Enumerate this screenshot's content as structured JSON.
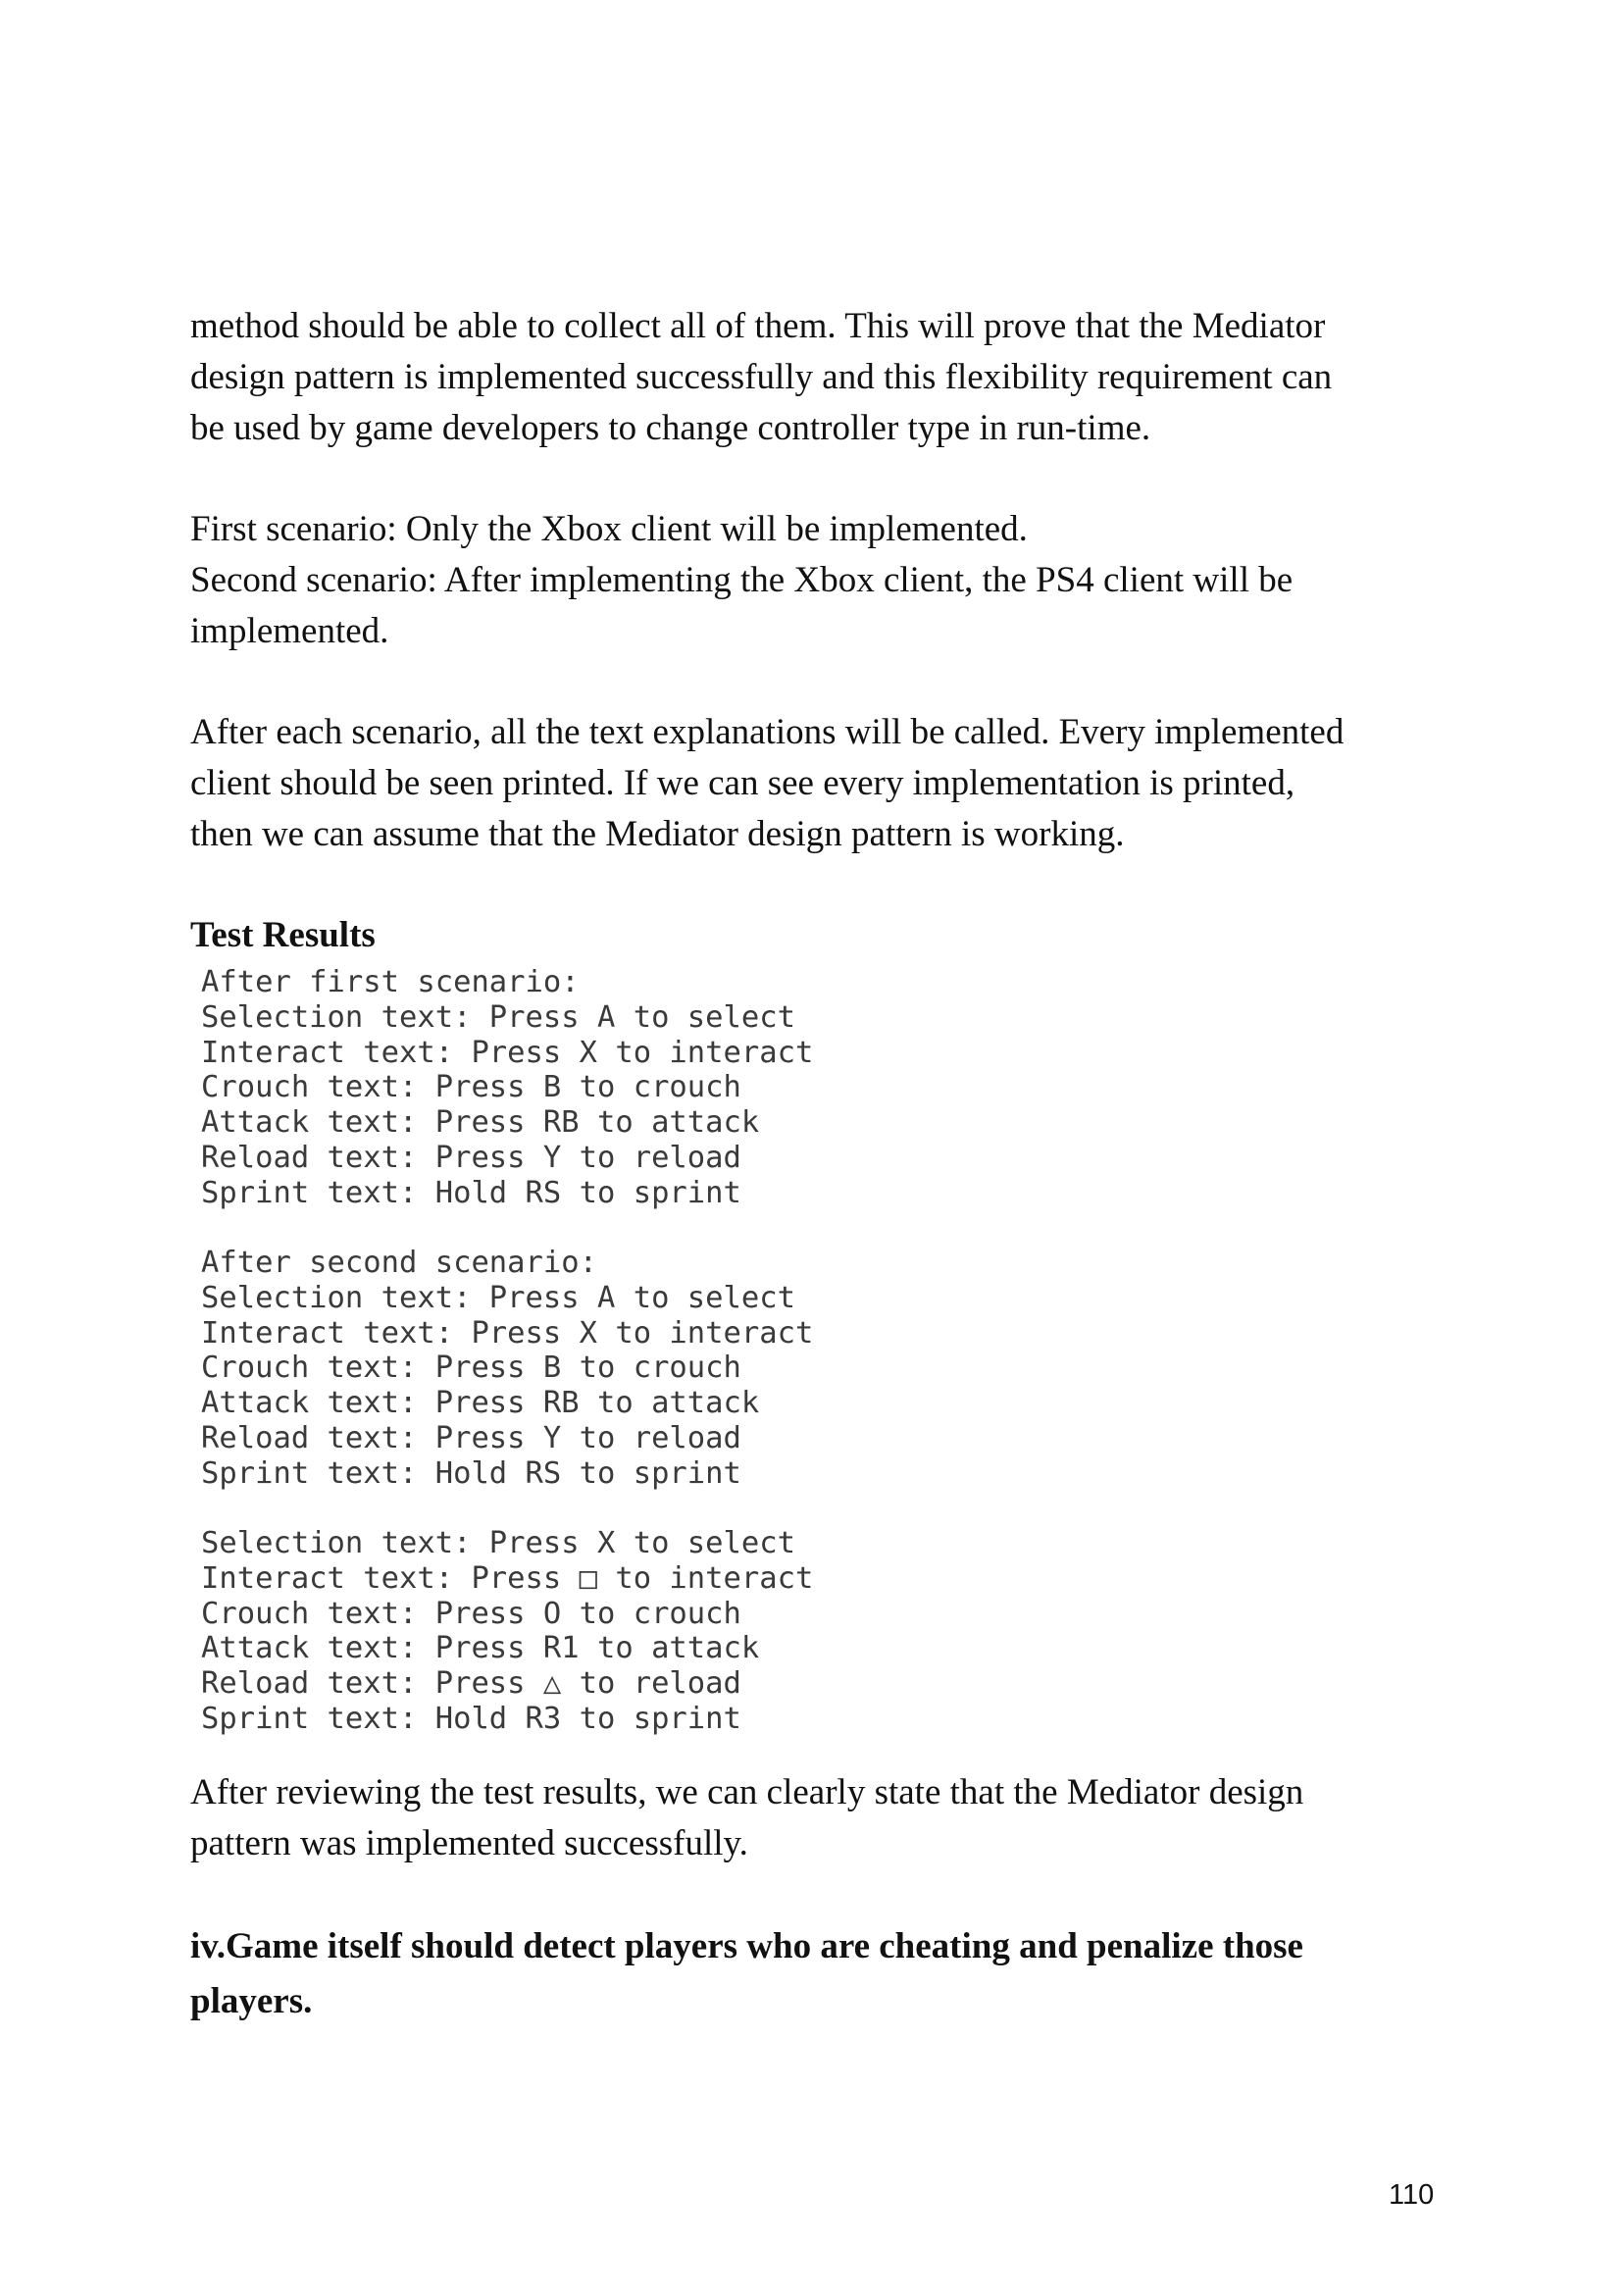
{
  "paragraphs": {
    "p1": [
      "method should be able to collect all of them. This will prove that the Mediator",
      "design pattern is implemented successfully and this flexibility requirement can",
      "be used by game developers to change controller type in run-time."
    ],
    "p2": [
      "First scenario: Only the Xbox client will be implemented.",
      "Second scenario: After implementing the Xbox client, the PS4 client will be",
      "implemented."
    ],
    "p3": [
      "After each scenario, all the text explanations will be called. Every implemented",
      "client should be seen printed. If we can see every implementation is printed,",
      "then we can assume that the Mediator design pattern is working."
    ],
    "p4": [
      "After reviewing the test results, we can clearly state that the Mediator design",
      "pattern was implemented successfully."
    ]
  },
  "test_results_heading": "Test Results",
  "output": {
    "block1": [
      "After first scenario:",
      "Selection text: Press A to select",
      "Interact text: Press X to interact",
      "Crouch text: Press B to crouch",
      "Attack text: Press RB to attack",
      "Reload text: Press Y to reload",
      "Sprint text: Hold RS to sprint"
    ],
    "block2": [
      "After second scenario:",
      "Selection text: Press A to select",
      "Interact text: Press X to interact",
      "Crouch text: Press B to crouch",
      "Attack text: Press RB to attack",
      "Reload text: Press Y to reload",
      "Sprint text: Hold RS to sprint"
    ],
    "block3": [
      "Selection text: Press X to select",
      "Interact text: Press □ to interact",
      "Crouch text: Press O to crouch",
      "Attack text: Press R1 to attack",
      "Reload text: Press △ to reload",
      "Sprint text: Hold R3 to sprint"
    ]
  },
  "section_heading": [
    "iv.Game itself should detect players who are cheating and penalize those",
    "players."
  ],
  "page_number": "110"
}
